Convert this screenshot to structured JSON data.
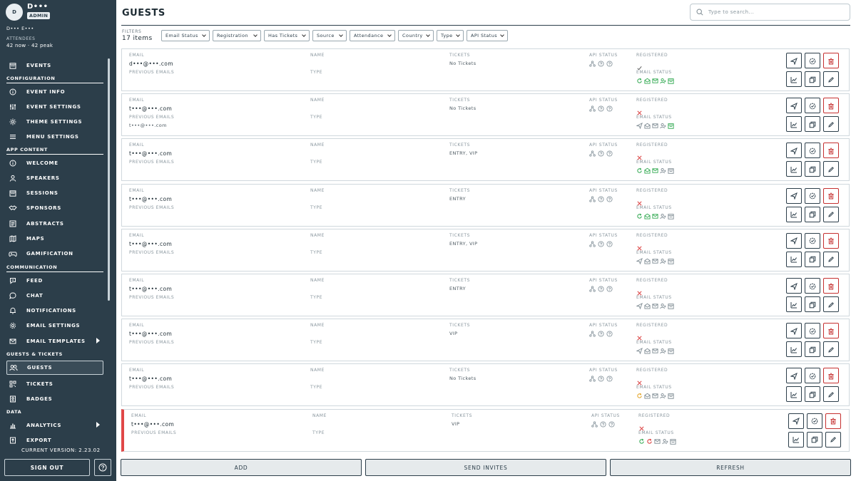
{
  "user": {
    "initial": "D",
    "name": "D•••",
    "role": "ADMIN"
  },
  "event_name": "D••• E•••",
  "attendees": {
    "title": "ATTENDEES",
    "value": "42 now · 42 peak"
  },
  "sidebar": {
    "events": "EVENTS",
    "sections": {
      "configuration": "CONFIGURATION",
      "app_content": "APP CONTENT",
      "communication": "COMMUNICATION",
      "guests_tickets": "GUESTS & TICKETS",
      "data": "DATA"
    },
    "configuration": [
      "EVENT INFO",
      "EVENT SETTINGS",
      "THEME SETTINGS",
      "MENU SETTINGS"
    ],
    "app_content": [
      "WELCOME",
      "SPEAKERS",
      "SESSIONS",
      "SPONSORS",
      "ABSTRACTS",
      "MAPS",
      "GAMIFICATION"
    ],
    "communication": [
      "FEED",
      "CHAT",
      "NOTIFICATIONS",
      "EMAIL SETTINGS",
      "EMAIL TEMPLATES"
    ],
    "guests_tickets": [
      "GUESTS",
      "TICKETS",
      "BADGES"
    ],
    "data": [
      "ANALYTICS",
      "EXPORT"
    ],
    "active": "GUESTS",
    "version": "CURRENT VERSION: 2.23.02",
    "sign_out": "SIGN OUT"
  },
  "page": {
    "title": "GUESTS",
    "search_placeholder": "Type to search..."
  },
  "filters": {
    "label": "FILTERS",
    "count": "17 items",
    "chips": [
      "Email Status",
      "Registration",
      "Has Tickets",
      "Source",
      "Attendance",
      "Country",
      "Type",
      "API Status"
    ]
  },
  "columns": {
    "email": "EMAIL",
    "previous_emails": "PREVIOUS EMAILS",
    "name": "NAME",
    "type": "TYPE",
    "tickets": "TICKETS",
    "api_status": "API STATUS",
    "registered": "REGISTERED",
    "email_status": "EMAIL STATUS"
  },
  "colors": {
    "sidebar": "#2c3e4a",
    "success": "#2fa84f",
    "error": "#d93636",
    "warning": "#e3a323",
    "neutral": "#7d8a92"
  },
  "guests": [
    {
      "email": "d•••@•••.com",
      "previous": "",
      "tickets": "No Tickets",
      "registered": "check",
      "flag": false,
      "email_status": [
        "success",
        "success",
        "success",
        "success",
        "success"
      ]
    },
    {
      "email": "t•••@•••.com",
      "previous": "t•••@•••.com",
      "tickets": "No Tickets",
      "registered": "x",
      "flag": false,
      "email_status": [
        "neutral",
        "neutral",
        "neutral",
        "neutral",
        "success"
      ]
    },
    {
      "email": "t•••@•••.com",
      "previous": "",
      "tickets": "ENTRY, VIP",
      "registered": "x",
      "flag": false,
      "email_status": [
        "success",
        "success",
        "success",
        "neutral",
        "neutral"
      ]
    },
    {
      "email": "t•••@•••.com",
      "previous": "",
      "tickets": "ENTRY",
      "registered": "x",
      "flag": false,
      "email_status": [
        "success",
        "success",
        "success",
        "neutral",
        "neutral"
      ]
    },
    {
      "email": "t•••@•••.com",
      "previous": "",
      "tickets": "ENTRY, VIP",
      "registered": "x",
      "flag": false,
      "email_status": [
        "neutral",
        "neutral",
        "neutral",
        "neutral",
        "neutral"
      ]
    },
    {
      "email": "t•••@•••.com",
      "previous": "",
      "tickets": "ENTRY",
      "registered": "x",
      "flag": false,
      "email_status": [
        "neutral",
        "neutral",
        "neutral",
        "neutral",
        "neutral"
      ]
    },
    {
      "email": "t•••@•••.com",
      "previous": "",
      "tickets": "VIP",
      "registered": "x",
      "flag": false,
      "email_status": [
        "neutral",
        "neutral",
        "neutral",
        "neutral",
        "neutral"
      ]
    },
    {
      "email": "t•••@•••.com",
      "previous": "",
      "tickets": "No Tickets",
      "registered": "x",
      "flag": false,
      "email_status": [
        "warning",
        "neutral",
        "neutral",
        "neutral",
        "neutral"
      ]
    },
    {
      "email": "t•••@•••.com",
      "previous": "",
      "tickets": "VIP",
      "registered": "x",
      "flag": true,
      "email_status": [
        "success",
        "error",
        "neutral",
        "neutral",
        "neutral"
      ]
    }
  ],
  "buttons": {
    "add": "ADD",
    "send_invites": "SEND INVITES",
    "refresh": "REFRESH"
  }
}
